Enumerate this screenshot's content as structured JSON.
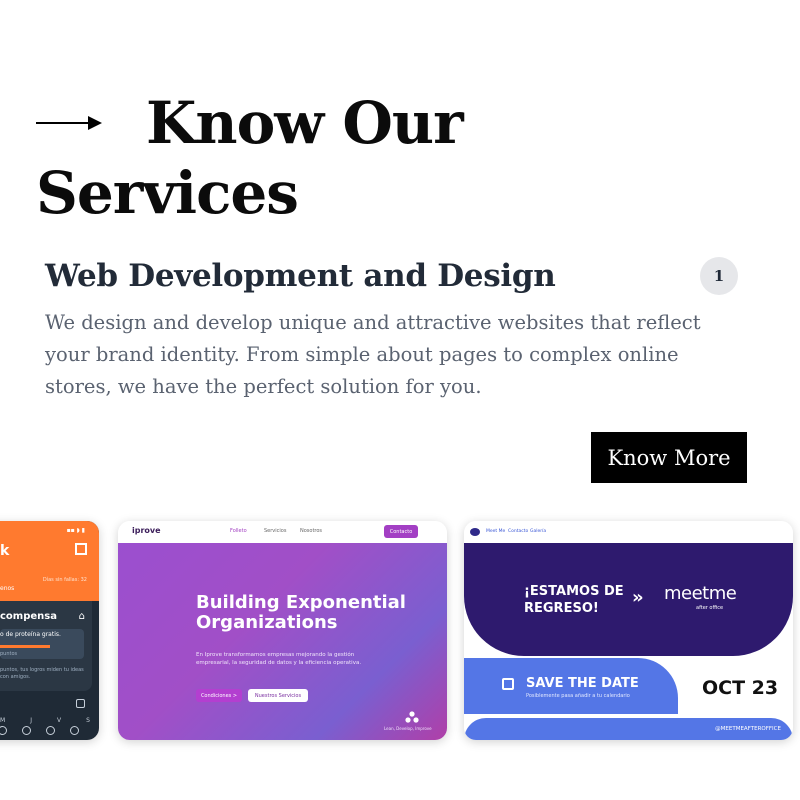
{
  "section": {
    "heading_line1": "Know Our",
    "heading_line2": "Services"
  },
  "service": {
    "title": "Web Development and Design",
    "number": "1",
    "description": "We design and develop unique and attractive websites that reflect your brand identity. From simple about pages to complex online stores, we have the perfect solution for you.",
    "cta_label": "Know More"
  },
  "cards": {
    "app": {
      "title_fragment": "k",
      "small_left": "enos",
      "small_right": "Días sin fallas: 32",
      "panel_title": "compensa",
      "reward_text": "o de proteína gratis.",
      "reward_sub": "puntos",
      "points_text": "puntos, tus logros miden tu ideas con amigos.",
      "days": [
        "M",
        "J",
        "V",
        "S"
      ]
    },
    "iprove": {
      "logo": "iprove",
      "nav": [
        "Folleto",
        "Servicios",
        "Nosotros"
      ],
      "contact": "Contacto",
      "headline": "Building Exponential Organizations",
      "body": "En Iprove transformamos empresas mejorando la gestión empresarial, la seguridad de datos y la eficiencia operativa.",
      "btn_primary": "Condiciones >",
      "btn_secondary": "Nuestros Servicios",
      "tagline": "Lean, Develop, Improve"
    },
    "meetme": {
      "nav": [
        "Meet Me",
        "Contacto",
        "Galería"
      ],
      "headline": "¡ESTAMOS DE REGRESO!",
      "chevron": "»",
      "brand": "meetme",
      "brand_sub": "after office",
      "save": "SAVE THE DATE",
      "save_sub": "Posiblemente pasa añadir a tu calendario",
      "date": "OCT 23",
      "handle": "@MEETMEAFTEROFFICE"
    }
  }
}
